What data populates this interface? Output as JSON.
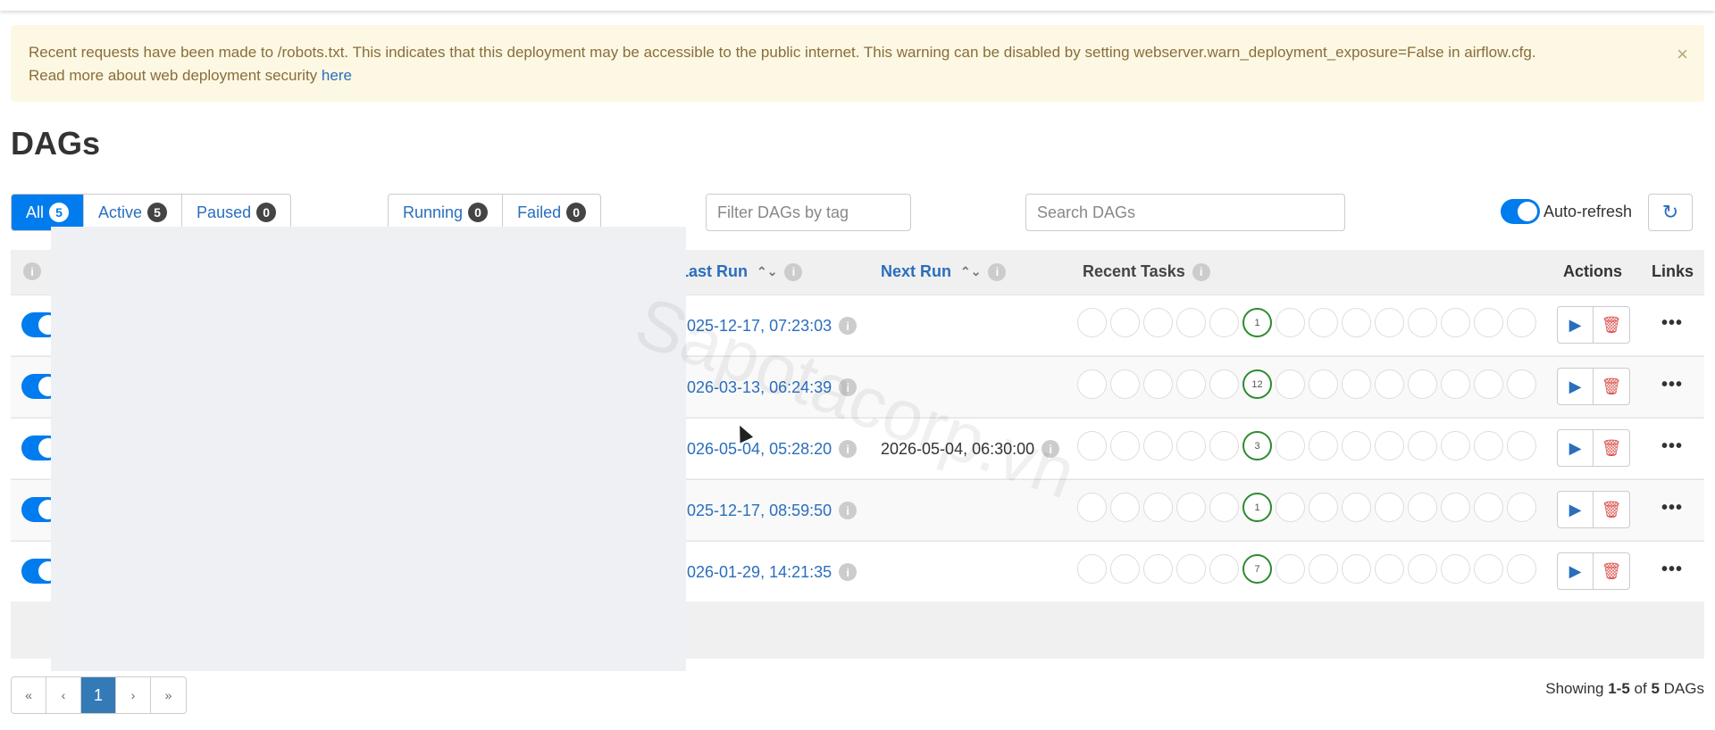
{
  "alert": {
    "text": "Recent requests have been made to /robots.txt. This indicates that this deployment may be accessible to the public internet. This warning can be disabled by setting webserver.warn_deployment_exposure=False in airflow.cfg.",
    "text2": "Read more about web deployment security",
    "link": "here",
    "close": "×"
  },
  "page_title": "DAGs",
  "status_tabs": [
    {
      "label": "All",
      "count": "5"
    },
    {
      "label": "Active",
      "count": "5"
    },
    {
      "label": "Paused",
      "count": "0"
    }
  ],
  "state_tabs": [
    {
      "label": "Running",
      "count": "0"
    },
    {
      "label": "Failed",
      "count": "0"
    }
  ],
  "filters": {
    "tag_placeholder": "Filter DAGs by tag",
    "search_placeholder": "Search DAGs"
  },
  "auto_refresh_label": "Auto-refresh",
  "refresh_icon": "↻",
  "columns": {
    "last_run": "Last Run",
    "next_run": "Next Run",
    "recent_tasks": "Recent Tasks",
    "actions": "Actions",
    "links": "Links"
  },
  "rows": [
    {
      "last_run": "025-12-17, 07:23:03",
      "next_run": "",
      "task_count": "1"
    },
    {
      "last_run": "026-03-13, 06:24:39",
      "next_run": "",
      "task_count": "12"
    },
    {
      "last_run": "026-05-04, 05:28:20",
      "next_run": "2026-05-04, 06:30:00",
      "task_count": "3"
    },
    {
      "last_run": "025-12-17, 08:59:50",
      "next_run": "",
      "task_count": "1"
    },
    {
      "last_run": "026-01-29, 14:21:35",
      "next_run": "",
      "task_count": "7"
    }
  ],
  "icons": {
    "info": "i",
    "sort": "⌃⌄",
    "play": "▶",
    "delete": "🗑",
    "links": "•••"
  },
  "pager": {
    "first": "«",
    "prev": "‹",
    "current": "1",
    "next": "›",
    "last": "»"
  },
  "showing": {
    "prefix": "Showing",
    "range": "1-5",
    "of": "of",
    "total": "5",
    "suffix": "DAGs"
  },
  "watermark": "Sapotacorp.vn",
  "colors": {
    "accent": "#017cee",
    "link": "#2a6ebd",
    "success": "#2e8b2e",
    "danger": "#d9534f",
    "alert_bg": "#fcf8e3"
  }
}
